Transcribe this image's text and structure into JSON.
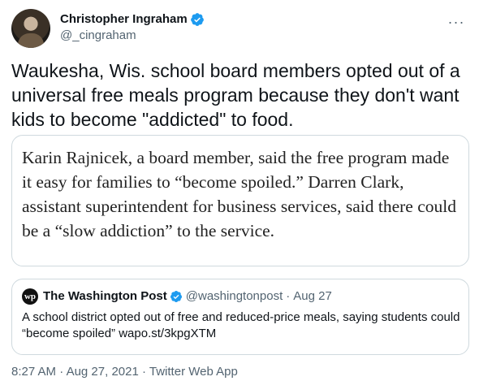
{
  "tweet": {
    "author": {
      "display_name": "Christopher Ingraham",
      "handle": "@_cingraham",
      "verified_icon": "verified-badge-icon"
    },
    "more_icon": "more-options-icon",
    "more_label": "···",
    "text": "Waukesha, Wis. school board members opted out of a\nuniversal free meals program because they don't want\nkids to become \"addicted\" to food.",
    "image_text": "Karin Rajnicek, a board member, said the free program made it easy for families to “become spoiled.” Darren Clark, assistant superintendent for business services, said there could be a “slow addiction” to the service.",
    "quoted_tweet": {
      "logo_text": "wp",
      "display_name": "The Washington Post",
      "handle": "@washingtonpost",
      "separator": "·",
      "date": "Aug 27",
      "text": "A school district opted out of free and reduced-price meals, saying students could “become spoiled” wapo.st/3kpgXTM"
    },
    "footer": {
      "time": "8:27 AM",
      "separator": "·",
      "date": "Aug 27, 2021",
      "separator2": "·",
      "app": "Twitter Web App"
    }
  },
  "colors": {
    "text": "#0f1419",
    "secondary": "#536471",
    "verified": "#1d9bf0",
    "border": "#cfd9de"
  }
}
